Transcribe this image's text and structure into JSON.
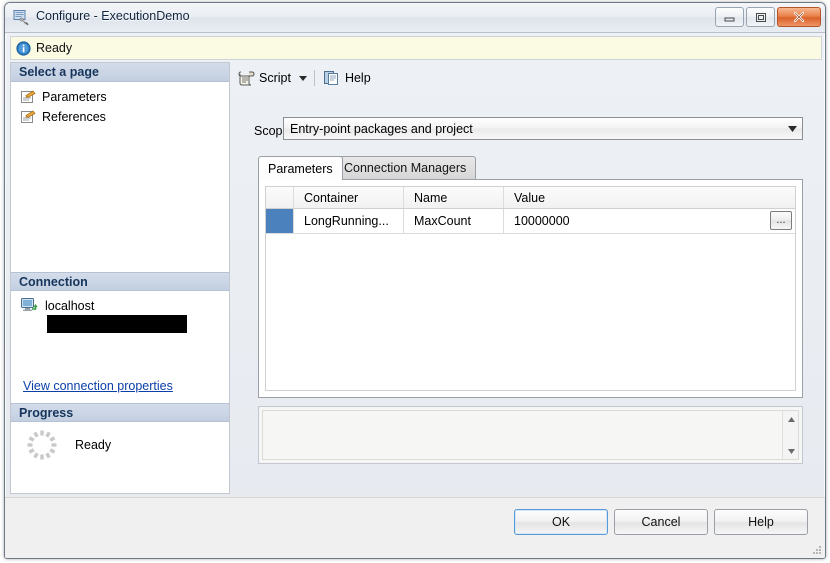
{
  "window": {
    "title": "Configure - ExecutionDemo",
    "title_icon": "configure-package-icon",
    "minimize_label": "Minimize",
    "maximize_label": "Maximize",
    "close_label": "Close"
  },
  "status": {
    "icon": "info-icon",
    "text": "Ready"
  },
  "sidebar": {
    "select_a_page": {
      "header": "Select a page",
      "items": [
        {
          "label": "Parameters",
          "icon": "page-parameters-icon"
        },
        {
          "label": "References",
          "icon": "page-references-icon"
        }
      ]
    },
    "connection": {
      "header": "Connection",
      "server_icon": "server-connection-icon",
      "server": "localhost",
      "redacted": "",
      "link": "View connection properties"
    },
    "progress": {
      "header": "Progress",
      "spinner_icon": "progress-spinner-icon",
      "text": "Ready"
    }
  },
  "toolbar": {
    "script_label": "Script",
    "script_icon": "script-scroll-icon",
    "script_caret_icon": "chevron-down-icon",
    "help_label": "Help",
    "help_icon": "help-pages-icon"
  },
  "scope": {
    "label": "Scope:",
    "value": "Entry-point packages and project",
    "arrow_icon": "chevron-down-icon"
  },
  "tabs": [
    {
      "label": "Parameters",
      "active": true
    },
    {
      "label": "Connection Managers",
      "active": false
    }
  ],
  "grid": {
    "columns": [
      "",
      "Container",
      "Name",
      "Value"
    ],
    "rows": [
      {
        "selected": true,
        "container": "LongRunning...",
        "name": "MaxCount",
        "value": "10000000",
        "browse_label": "..."
      }
    ]
  },
  "description": {
    "text": "",
    "scroll_up_icon": "scroll-up-arrow-icon",
    "scroll_down_icon": "scroll-down-arrow-icon"
  },
  "footer": {
    "ok": "OK",
    "cancel": "Cancel",
    "help": "Help",
    "grip_icon": "resize-grip-icon"
  },
  "colors": {
    "accent_blue": "#4b81bd",
    "status_yellow": "#fbfbe4",
    "section_header": "#c3cfe1",
    "link_blue": "#0b3fa8",
    "close_red": "#d9622b"
  }
}
